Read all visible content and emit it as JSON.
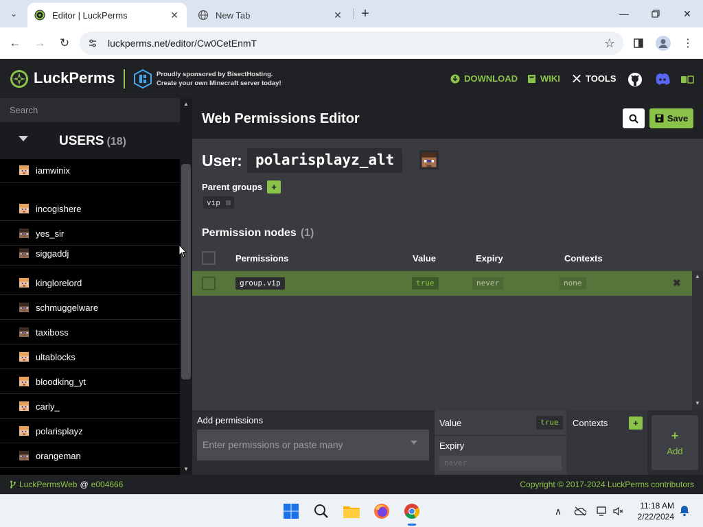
{
  "browser": {
    "tabs": [
      {
        "title": "Editor | LuckPerms",
        "active": true
      },
      {
        "title": "New Tab",
        "active": false
      }
    ],
    "url": "luckperms.net/editor/Cw0CetEnmT"
  },
  "header": {
    "brand": "LuckPerms",
    "sponsor_line1": "Proudly sponsored by BisectHosting.",
    "sponsor_line2": "Create your own Minecraft server today!",
    "nav": {
      "download": "DOWNLOAD",
      "wiki": "WIKI",
      "tools": "TOOLS"
    }
  },
  "sidebar": {
    "search_placeholder": "Search",
    "users_title": "USERS",
    "users_count": "(18)",
    "users": [
      {
        "name": "iamwinix",
        "skin": "light"
      },
      {
        "name": "incogishere",
        "skin": "light"
      },
      {
        "name": "yes_sir",
        "skin": "dark"
      },
      {
        "name": "siggaddj",
        "skin": "dark"
      },
      {
        "name": "kinglorelord",
        "skin": "light"
      },
      {
        "name": "schmuggelware",
        "skin": "dark"
      },
      {
        "name": "taxiboss",
        "skin": "dark"
      },
      {
        "name": "ultablocks",
        "skin": "light"
      },
      {
        "name": "bloodking_yt",
        "skin": "light"
      },
      {
        "name": "carly_",
        "skin": "light"
      },
      {
        "name": "polarisplayz",
        "skin": "light"
      },
      {
        "name": "orangeman",
        "skin": "dark"
      }
    ]
  },
  "editor": {
    "title": "Web Permissions Editor",
    "save_label": "Save",
    "user_label": "User:",
    "username": "polarisplayz_alt",
    "parent_groups_label": "Parent groups",
    "parent_groups": [
      "vip"
    ],
    "permission_nodes_label": "Permission nodes",
    "permission_nodes_count": "(1)",
    "columns": {
      "permissions": "Permissions",
      "value": "Value",
      "expiry": "Expiry",
      "contexts": "Contexts"
    },
    "nodes": [
      {
        "permission": "group.vip",
        "value": "true",
        "expiry": "never",
        "contexts": "none"
      }
    ],
    "add": {
      "label": "Add permissions",
      "placeholder": "Enter permissions or paste many",
      "value_label": "Value",
      "value": "true",
      "expiry_label": "Expiry",
      "expiry_placeholder": "never",
      "contexts_label": "Contexts",
      "add_button": "Add"
    }
  },
  "footer": {
    "left_name": "LuckPermsWeb",
    "left_at": "@",
    "left_commit": "e004666",
    "copyright": "Copyright © 2017-2024 LuckPerms contributors"
  },
  "taskbar": {
    "time": "11:18 AM",
    "date": "2/22/2024"
  },
  "colors": {
    "accent": "#8bc34a",
    "row_selected": "#57743a",
    "header_bg": "#202124",
    "panel_bg": "#3a3b40"
  }
}
